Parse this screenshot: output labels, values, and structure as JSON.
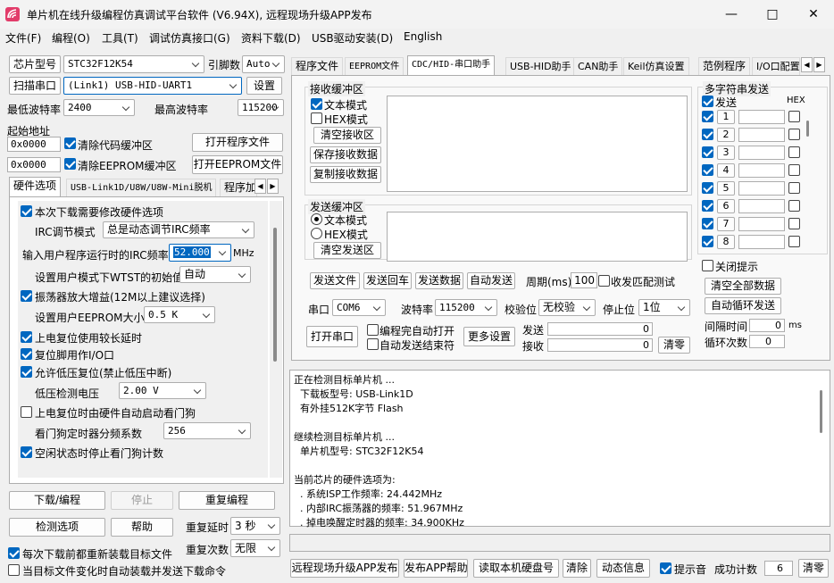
{
  "app": {
    "title": "单片机在线升级编程仿真调试平台软件 (V6.94X), 远程现场升级APP发布"
  },
  "menu": [
    "文件(F)",
    "编程(O)",
    "工具(T)",
    "调试仿真接口(G)",
    "资料下载(D)",
    "USB驱动安装(D)",
    "English"
  ],
  "left": {
    "chip_label": "芯片型号",
    "chip_value": "STC32F12K54",
    "pins_label": "引脚数",
    "pins_value": "Auto",
    "scan_label": "扫描串口",
    "port_value": "(Link1) USB-HID-UART1",
    "settings_label": "设置",
    "min_baud_label": "最低波特率",
    "min_baud_value": "2400",
    "max_baud_label": "最高波特率",
    "max_baud_value": "115200",
    "start_addr_label": "起始地址",
    "addr1": "0x0000",
    "clear_code_label": "清除代码缓冲区",
    "open_prog_label": "打开程序文件",
    "addr2": "0x0000",
    "clear_eeprom_label": "清除EEPROM缓冲区",
    "open_eeprom_label": "打开EEPROM文件",
    "tabs": [
      "硬件选项",
      "USB-Link1D/U8W/U8W-Mini脱机",
      "程序加"
    ],
    "hw": {
      "modify_hw": "本次下载需要修改硬件选项",
      "irc_mode_label": "IRC调节模式",
      "irc_mode_value": "总是动态调节IRC频率",
      "irc_freq_label": "输入用户程序运行时的IRC频率",
      "irc_freq_value": "52.000",
      "irc_unit": "MHz",
      "wtst_label": "设置用户模式下WTST的初始值",
      "wtst_value": "自动",
      "osc_gain": "振荡器放大增益(12M以上建议选择)",
      "eeprom_size_label": "设置用户EEPROM大小",
      "eeprom_size_value": "0.5 K",
      "por_delay": "上电复位使用较长延时",
      "reset_pin": "复位脚用作I/O口",
      "lvr": "允许低压复位(禁止低压中断)",
      "lvd_label": "低压检测电压",
      "lvd_value": "2.00 V",
      "wdt_auto": "上电复位时由硬件自动启动看门狗",
      "wdt_div_label": "看门狗定时器分频系数",
      "wdt_div_value": "256",
      "wdt_idle": "空闲状态时停止看门狗计数"
    },
    "download_label": "下载/编程",
    "stop_label": "停止",
    "reprogram_label": "重复编程",
    "detect_label": "检测选项",
    "help_label": "帮助",
    "repeat_delay_label": "重复延时",
    "repeat_delay_value": "3 秒",
    "repeat_count_label": "重复次数",
    "repeat_count_value": "无限",
    "reload_label": "每次下载前都重新装载目标文件",
    "auto_send_label": "当目标文件变化时自动装载并发送下载命令"
  },
  "right": {
    "tabs": [
      "程序文件",
      "EEPROM文件",
      "CDC/HID-串口助手",
      "USB-HID助手",
      "CAN助手",
      "Keil仿真设置",
      "范例程序",
      "I/O口配置"
    ],
    "recv": {
      "title": "接收缓冲区",
      "text_mode": "文本模式",
      "hex_mode": "HEX模式",
      "clear": "清空接收区",
      "save": "保存接收数据",
      "copy": "复制接收数据"
    },
    "send": {
      "title": "发送缓冲区",
      "text_mode": "文本模式",
      "hex_mode": "HEX模式",
      "clear": "清空发送区"
    },
    "send_file": "发送文件",
    "send_return": "发送回车",
    "send_data": "发送数据",
    "auto_send": "自动发送",
    "period_label": "周期(ms)",
    "period_value": "100",
    "match_label": "收发匹配测试",
    "port_label": "串口",
    "port_value": "COM6",
    "baud_label": "波特率",
    "baud_value": "115200",
    "parity_label": "校验位",
    "parity_value": "无校验",
    "stop_label": "停止位",
    "stop_value": "1位",
    "open_port": "打开串口",
    "auto_open": "编程完自动打开",
    "auto_close": "自动发送结束符",
    "more": "更多设置",
    "tx_label": "发送",
    "tx_value": "0",
    "rx_label": "接收",
    "rx_value": "0",
    "clear_count": "清零",
    "multi": {
      "title": "多字符串发送",
      "send_col": "发送",
      "hex_col": "HEX",
      "rows": [
        "1",
        "2",
        "3",
        "4",
        "5",
        "6",
        "7",
        "8"
      ],
      "close_tip": "关闭提示",
      "clear_all": "清空全部数据",
      "auto_loop": "自动循环发送",
      "interval_label": "间隔时间",
      "interval_value": "0",
      "interval_unit": "ms",
      "loop_label": "循环次数",
      "loop_value": "0"
    }
  },
  "log": [
    "正在检测目标单片机 ...",
    "  下载板型号: USB-Link1D",
    "  有外挂512K字节 Flash",
    "",
    "继续检测目标单片机 ...",
    "  单片机型号: STC32F12K54",
    "",
    "当前芯片的硬件选项为:",
    "  . 系统ISP工作频率: 24.442MHz",
    "  . 内部IRC振荡器的频率: 51.967MHz",
    "  . 掉电唤醒定时器的频率: 34.900KHz"
  ],
  "bottom": {
    "publish": "远程现场升级APP发布",
    "help": "发布APP帮助",
    "read_disk": "读取本机硬盘号",
    "clear": "清除",
    "anim": "动态信息",
    "beep": "提示音",
    "success_label": "成功计数",
    "success_value": "6",
    "clear_count": "清零"
  },
  "colors": {
    "accent": "#0067c0",
    "highlight": "#cce4f7"
  }
}
